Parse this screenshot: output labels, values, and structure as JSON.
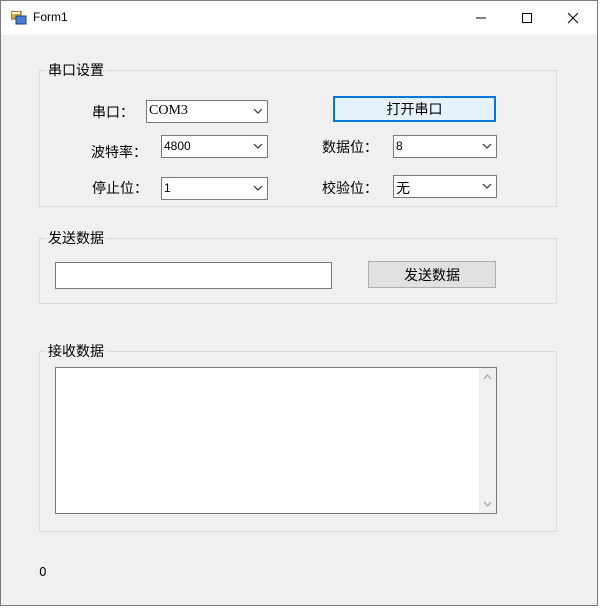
{
  "window": {
    "title": "Form1"
  },
  "serial_group": {
    "title": "串口设置",
    "port_label": "串口：",
    "port_value": "COM3",
    "baud_label": "波特率：",
    "baud_value": "4800",
    "stop_label": "停止位：",
    "stop_value": "1",
    "data_bits_label": "数据位：",
    "data_bits_value": "8",
    "parity_label": "校验位：",
    "parity_value": "无",
    "open_button": "打开串口"
  },
  "send_group": {
    "title": "发送数据",
    "input_value": "",
    "send_button": "发送数据"
  },
  "receive_group": {
    "title": "接收数据",
    "content": ""
  },
  "status": {
    "count": "0"
  },
  "colors": {
    "accent": "#0078d7",
    "face": "#f0f0f0"
  }
}
